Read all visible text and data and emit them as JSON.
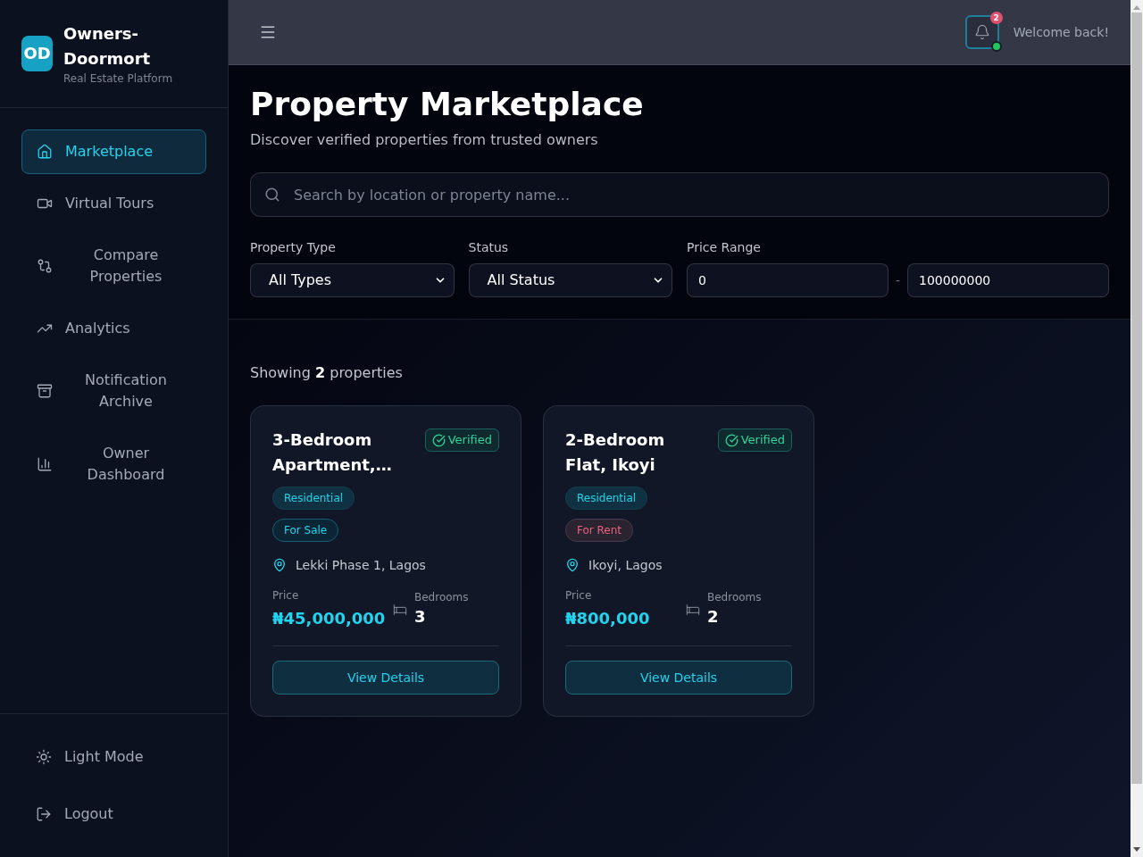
{
  "sidebar": {
    "logo": "OD",
    "brand": "Owners-Doormort",
    "tagline": "Real Estate Platform",
    "nav": [
      {
        "label": "Marketplace",
        "selected": true
      },
      {
        "label": "Virtual Tours",
        "selected": false
      },
      {
        "label": "Compare Properties",
        "selected": false
      },
      {
        "label": "Analytics",
        "selected": false
      },
      {
        "label": "Notification Archive",
        "selected": false
      },
      {
        "label": "Owner Dashboard",
        "selected": false
      }
    ],
    "footer": [
      {
        "label": "Light Mode"
      },
      {
        "label": "Logout"
      }
    ]
  },
  "header": {
    "notification_count": "2",
    "welcome": "Welcome back!"
  },
  "page": {
    "title": "Property Marketplace",
    "subtitle": "Discover verified properties from trusted owners",
    "search": {
      "placeholder": "Search by location or property name..."
    }
  },
  "filters": [
    {
      "kind": "select",
      "label": "Property Type",
      "value": "All Types"
    },
    {
      "kind": "select",
      "label": "Status",
      "value": "All Status"
    },
    {
      "kind": "range",
      "label": "Price Range",
      "min": "0",
      "separator": "-",
      "max": "100000000"
    }
  ],
  "results": "Showing **2** properties",
  "properties": [
    {
      "title": "3-Bedroom Apartment,…",
      "badge": "Verified",
      "category": "Residential",
      "listing": {
        "label": "For Sale",
        "kind": "sale"
      },
      "location": "Lekki Phase 1, Lagos",
      "price_label": "Price",
      "price": "₦45,000,000",
      "bedrooms_label": "Bedrooms",
      "bedrooms": "3",
      "button": "View Details"
    },
    {
      "title": "2-Bedroom Flat, Ikoyi",
      "badge": "Verified",
      "category": "Residential",
      "listing": {
        "label": "For Rent",
        "kind": "rent"
      },
      "location": "Ikoyi, Lagos",
      "price_label": "Price",
      "price": "₦800,000",
      "bedrooms_label": "Bedrooms",
      "bedrooms": "2",
      "button": "View Details"
    }
  ]
}
